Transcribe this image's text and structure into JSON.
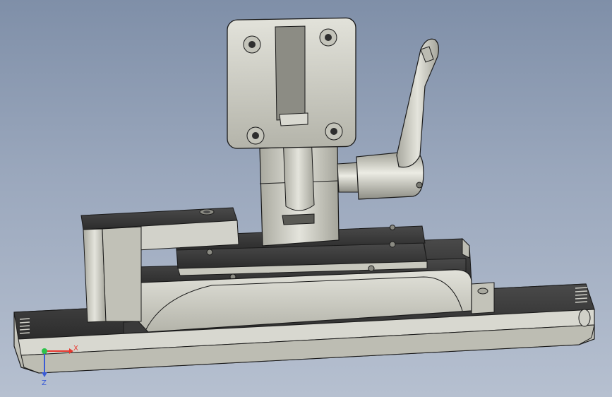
{
  "viewport": {
    "background_top": "#7f8fa8",
    "background_bottom": "#b6c0d0",
    "model_color": "#c9c9bf",
    "model_dark": "#3b3b3b",
    "edge_color": "#1a1a1a"
  },
  "triad": {
    "x_label": "X",
    "z_label": "Z",
    "x_color": "#e8382f",
    "y_color": "#2ec24a",
    "z_color": "#3a5bd6"
  }
}
